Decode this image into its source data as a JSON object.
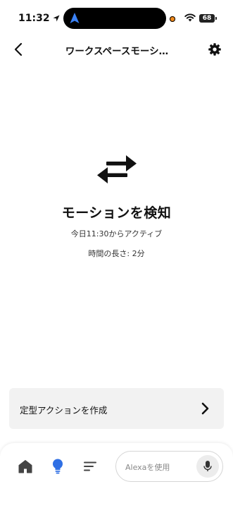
{
  "status_bar": {
    "time": "11:32",
    "battery": "68"
  },
  "header": {
    "title": "ワークスペースモーシ…"
  },
  "event": {
    "title": "モーションを検知",
    "active_since": "今日11:30からアクティブ",
    "duration": "時間の長さ: 2分"
  },
  "routine": {
    "label": "定型アクションを作成"
  },
  "bottom_nav": {
    "alexa_placeholder": "Alexaを使用"
  },
  "colors": {
    "accent": "#2f6fe4",
    "recording_dot": "#f08a1c"
  }
}
